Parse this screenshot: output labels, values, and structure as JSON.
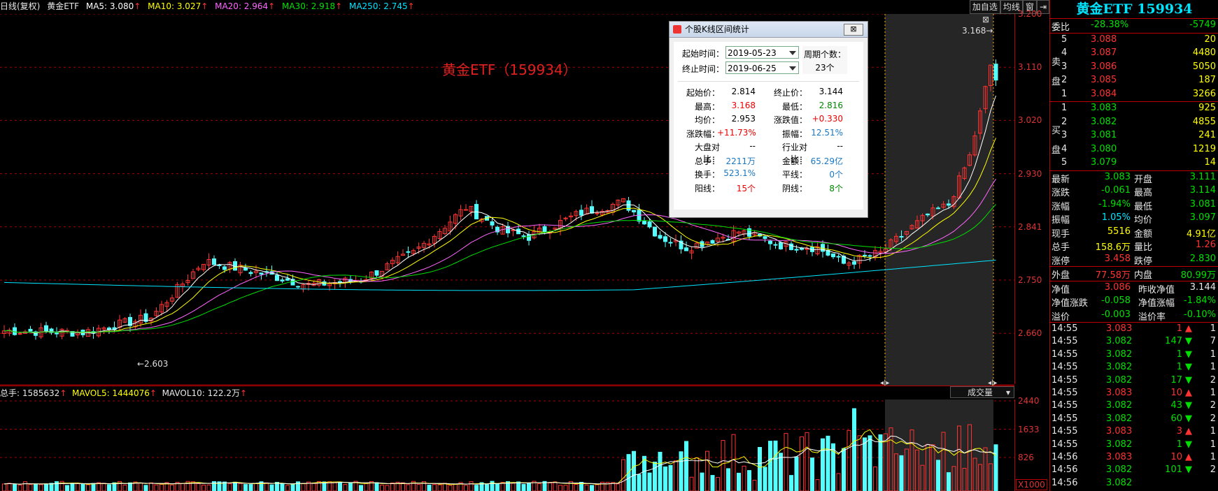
{
  "topbar": {
    "period": "日线(复权)",
    "name": "黄金ETF",
    "ma5": "MA5: 3.080",
    "ma10": "MA10: 3.027",
    "ma20": "MA20: 2.964",
    "ma30": "MA30: 2.918",
    "ma250": "MA250: 2.745",
    "arrow": "↑",
    "buttons": [
      "加自选",
      "均线",
      "窗",
      "⇥"
    ]
  },
  "colors": {
    "ma5": "#ffffff",
    "ma10": "#ffff00",
    "ma20": "#ff66ff",
    "ma30": "#00e000",
    "ma250": "#00e5ff",
    "up": "#ff3232",
    "down": "#54ffff",
    "grid": "#aa0000"
  },
  "chart": {
    "title": "黄金ETF（159934）",
    "price_ticks": [
      "3.200",
      "3.110",
      "3.020",
      "2.930",
      "2.841",
      "2.750",
      "2.660"
    ],
    "low_label": "2.603",
    "high_label": "3.168"
  },
  "volume": {
    "total": "总手: 1585632",
    "mavol5": "MAVOL5: 1444076",
    "mavol10": "MAVOL10: 122.2万",
    "arrow": "↑",
    "selector": "成交量",
    "ticks": [
      "2440",
      "1633",
      "826"
    ],
    "unit": "X1000"
  },
  "popup": {
    "title": "个股K线区间统计",
    "close": "⊠",
    "start_label": "起始时间：",
    "start_value": "2019-05-23",
    "end_label": "终止时间：",
    "end_value": "2019-06-25",
    "period_label": "周期个数：",
    "period_value": "23个",
    "stats": [
      [
        "起始价：",
        "2.814",
        "black",
        "终止价：",
        "3.144",
        "black"
      ],
      [
        "最高：",
        "3.168",
        "red",
        "最低：",
        "2.816",
        "green"
      ],
      [
        "均价：",
        "2.953",
        "black",
        "涨跌值：",
        "+0.330",
        "red"
      ],
      [
        "涨跌幅：",
        "+11.73%",
        "red",
        "振幅：",
        "12.51%",
        "blue"
      ],
      [
        "大盘对比：",
        "--",
        "black",
        "行业对比：",
        "--",
        "black"
      ],
      [
        "总手：",
        "2211万",
        "blue",
        "金额：",
        "65.29亿",
        "blue"
      ],
      [
        "换手：",
        "523.1%",
        "blue",
        "平线：",
        "0个",
        "blue"
      ],
      [
        "阳线：",
        "15个",
        "red",
        "阴线：",
        "8个",
        "green"
      ]
    ]
  },
  "right": {
    "title": "黄金ETF 159934",
    "weibi": [
      "委比",
      "-28.38%",
      "-5749"
    ],
    "sell_label": [
      "卖",
      "盘"
    ],
    "buy_label": [
      "买",
      "盘"
    ],
    "asks": [
      [
        "5",
        "3.088",
        "20"
      ],
      [
        "4",
        "3.087",
        "4480"
      ],
      [
        "3",
        "3.086",
        "5050"
      ],
      [
        "2",
        "3.085",
        "187"
      ],
      [
        "1",
        "3.084",
        "3266"
      ]
    ],
    "bids": [
      [
        "1",
        "3.083",
        "925"
      ],
      [
        "2",
        "3.082",
        "4855"
      ],
      [
        "3",
        "3.081",
        "241"
      ],
      [
        "4",
        "3.080",
        "1219"
      ],
      [
        "5",
        "3.079",
        "14"
      ]
    ],
    "quote": [
      [
        "最新",
        "3.083",
        "green",
        "开盘",
        "3.111",
        "green"
      ],
      [
        "涨跌",
        "-0.061",
        "green",
        "最高",
        "3.114",
        "green"
      ],
      [
        "涨幅",
        "-1.94%",
        "green",
        "最低",
        "3.081",
        "green"
      ],
      [
        "振幅",
        "1.05%",
        "cyan",
        "均价",
        "3.097",
        "green"
      ],
      [
        "现手",
        "5516",
        "yellow",
        "金额",
        "4.91亿",
        "yellow"
      ],
      [
        "总手",
        "158.6万",
        "yellow",
        "量比",
        "1.26",
        "red"
      ],
      [
        "涨停",
        "3.458",
        "red",
        "跌停",
        "2.830",
        "green"
      ]
    ],
    "outer": [
      "外盘",
      "77.58万",
      "内盘",
      "80.99万"
    ],
    "nav": [
      [
        "净值",
        "3.086",
        "red",
        "昨收净值",
        "3.144",
        "white"
      ],
      [
        "净值涨跌",
        "-0.058",
        "green",
        "净值涨幅",
        "-1.84%",
        "green"
      ],
      [
        "溢价",
        "-0.003",
        "green",
        "溢价率",
        "-0.10%",
        "green"
      ]
    ],
    "ticks": [
      [
        "14:55",
        "3.083",
        "1",
        "up",
        "1"
      ],
      [
        "14:55",
        "3.082",
        "147",
        "down",
        "7"
      ],
      [
        "14:55",
        "3.082",
        "1",
        "down",
        "1"
      ],
      [
        "14:55",
        "3.082",
        "1",
        "down",
        "1"
      ],
      [
        "14:55",
        "3.082",
        "17",
        "down",
        "2"
      ],
      [
        "14:55",
        "3.083",
        "10",
        "up",
        "1"
      ],
      [
        "14:55",
        "3.082",
        "43",
        "down",
        "2"
      ],
      [
        "14:55",
        "3.082",
        "60",
        "down",
        "2"
      ],
      [
        "14:55",
        "3.083",
        "3",
        "up",
        "1"
      ],
      [
        "14:55",
        "3.082",
        "1",
        "down",
        "1"
      ],
      [
        "14:56",
        "3.083",
        "10",
        "up",
        "1"
      ],
      [
        "14:56",
        "3.082",
        "101",
        "down",
        "2"
      ],
      [
        "14:56",
        "3.082",
        "",
        "down",
        ""
      ]
    ]
  }
}
